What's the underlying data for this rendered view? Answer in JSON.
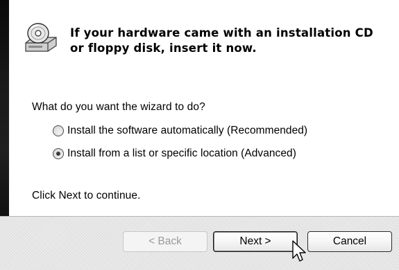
{
  "wizard": {
    "header": {
      "icon": "cd-drive-icon",
      "line1": "If your hardware came with an installation CD",
      "line2": "or floppy disk, insert it now."
    },
    "question": "What do you want the wizard to do?",
    "options": [
      {
        "label": "Install the software automatically (Recommended)",
        "selected": false
      },
      {
        "label": "Install from a list or specific location (Advanced)",
        "selected": true
      }
    ],
    "footer_note": "Click Next to continue."
  },
  "buttons": {
    "back_label": "< Back",
    "back_enabled": false,
    "next_label": "Next >",
    "cancel_label": "Cancel"
  },
  "colors": {
    "sidebar": "#111111",
    "button_bar": "#ececec",
    "disabled_text": "#9a9a9a"
  }
}
